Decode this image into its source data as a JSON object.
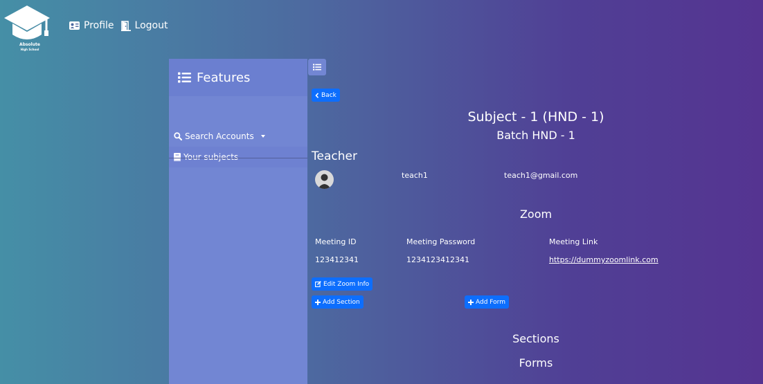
{
  "brand": {
    "name": "Absolute",
    "tagline": "High School"
  },
  "topnav": {
    "profile_label": "Profile",
    "logout_label": "Logout"
  },
  "sidebar": {
    "title": "Features",
    "items": [
      {
        "label": "Search Accounts",
        "icon": "search-icon",
        "dropdown": true
      },
      {
        "label": "Your subjects",
        "icon": "book-icon",
        "active": true
      }
    ]
  },
  "main": {
    "back_label": "Back",
    "subject_title": "Subject - 1 (HND - 1)",
    "batch_title": "Batch HND - 1",
    "teacher": {
      "heading": "Teacher",
      "name": "teach1",
      "email": "teach1@gmail.com"
    },
    "zoom": {
      "heading": "Zoom",
      "headers": [
        "Meeting ID",
        "Meeting Password",
        "Meeting Link"
      ],
      "values": [
        "123412341",
        "1234123412341",
        "https://dummyzoomlink.com"
      ]
    },
    "edit_zoom_label": "Edit Zoom Info",
    "add_section_label": "Add Section",
    "add_form_label": "Add Form",
    "sections_heading": "Sections",
    "forms_heading": "Forms"
  },
  "colors": {
    "primary_button": "#0d6efd",
    "sidebar": "#7286d3",
    "sidebar_header": "#6b7fd0"
  }
}
